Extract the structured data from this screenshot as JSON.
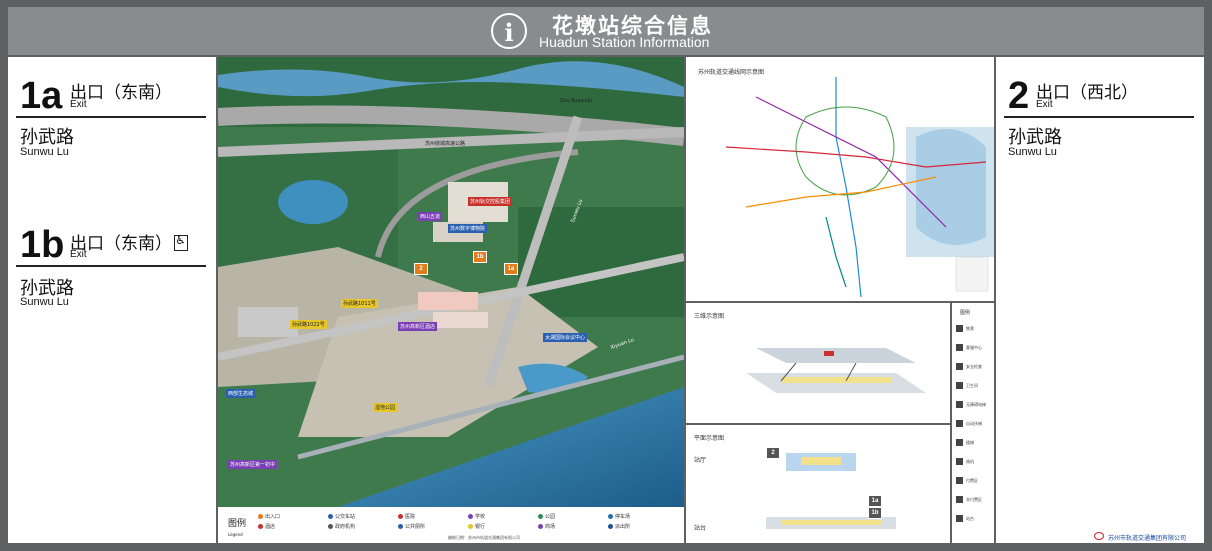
{
  "header": {
    "info_symbol": "i",
    "title_zh": "花墩站综合信息",
    "title_en": "Huadun Station Information"
  },
  "exits_left": [
    {
      "number": "1a",
      "name_zh": "出口（东南）",
      "exit_en": "Exit",
      "road_zh": "孙武路",
      "road_en": "Sunwu Lu",
      "accessible": false
    },
    {
      "number": "1b",
      "name_zh": "出口（东南）",
      "exit_en": "Exit",
      "road_zh": "孙武路",
      "road_en": "Sunwu Lu",
      "accessible": true
    }
  ],
  "exits_right": [
    {
      "number": "2",
      "name_zh": "出口（西北）",
      "exit_en": "Exit",
      "road_zh": "孙武路",
      "road_en": "Sunwu Lu"
    }
  ],
  "area_map": {
    "labels": [
      {
        "text": "Zou Kuaisulu",
        "style": "plain"
      },
      {
        "text": "苏州绕城高速公路",
        "style": "plain"
      },
      {
        "text": "苏州轨交控股集团",
        "style": "red"
      },
      {
        "text": "西山五道",
        "style": "purple"
      },
      {
        "text": "苏州数字博物院",
        "style": "blue"
      },
      {
        "text": "孙武路1011号",
        "style": "yellow"
      },
      {
        "text": "孙武路1022号",
        "style": "yellow"
      },
      {
        "text": "苏州高新区酒店",
        "style": "purple"
      },
      {
        "text": "太湖国际会议中心",
        "style": "blue"
      },
      {
        "text": "湿地公园",
        "style": "yellow"
      },
      {
        "text": "西部生态城",
        "style": "blue"
      },
      {
        "text": "苏州高新区第一初中",
        "style": "purple"
      }
    ],
    "exit_tags": [
      "2",
      "1b",
      "1a"
    ],
    "road_labels": [
      "Sunwu Lu",
      "Xiyuan Lu"
    ]
  },
  "legend": {
    "title_zh": "图例",
    "title_en": "Legend",
    "items": [
      {
        "label": "出入口",
        "color": "#e57c1b"
      },
      {
        "label": "公交车站",
        "color": "#2a5fb0"
      },
      {
        "label": "医院",
        "color": "#c9302c"
      },
      {
        "label": "学校",
        "color": "#7b3fb5"
      },
      {
        "label": "公园",
        "color": "#2e8b57"
      },
      {
        "label": "停车场",
        "color": "#1f6fb5"
      },
      {
        "label": "酒店",
        "color": "#c9302c"
      },
      {
        "label": "政府机构",
        "color": "#555555"
      },
      {
        "label": "公共厕所",
        "color": "#2a5fb0"
      },
      {
        "label": "银行",
        "color": "#e7c629"
      },
      {
        "label": "商场",
        "color": "#7b3fb5"
      },
      {
        "label": "派出所",
        "color": "#1f4fa0"
      }
    ],
    "footnote": "编制日期：苏州市轨道交通集团有限公司"
  },
  "metro_map": {
    "title": "苏州轨道交通线网示意图",
    "line_colors": [
      "#d7263d",
      "#1e88e5",
      "#8e24aa",
      "#43a047",
      "#fb8c00",
      "#00897b"
    ]
  },
  "section_diagram": {
    "title": "三维示意图"
  },
  "plan_diagram": {
    "title": "平面示意图",
    "floor_labels": [
      "站厅",
      "站台"
    ],
    "exit_labels": [
      "2",
      "1a",
      "1b"
    ]
  },
  "side_legend": {
    "title": "图例",
    "items": [
      "售票",
      "客服中心",
      "安全检查",
      "卫生间",
      "无障碍电梯",
      "自动扶梯",
      "楼梯",
      "闸机",
      "付费区",
      "非付费区",
      "站台"
    ]
  },
  "company": {
    "name": "苏州市轨道交通集团有限公司"
  },
  "colors": {
    "header_bg": "#8a8b8d",
    "frame_bg": "#5f6062",
    "exit_accent": "#e57c1b"
  }
}
